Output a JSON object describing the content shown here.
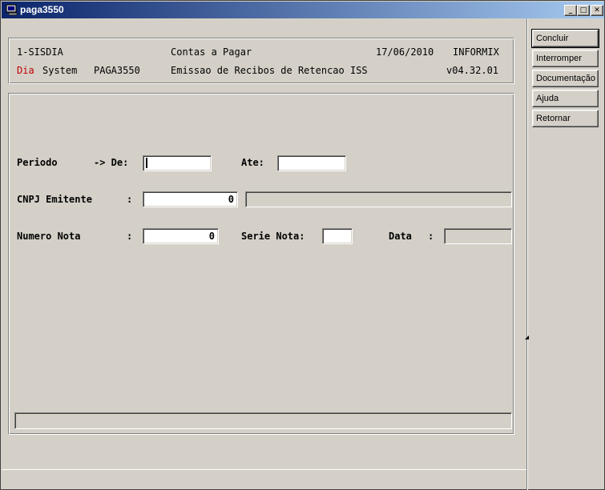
{
  "window": {
    "title": "paga3550",
    "minimize_glyph": "_",
    "maximize_glyph": "□",
    "close_glyph": "✕"
  },
  "header": {
    "company": "1-SISDIA",
    "module": "Contas a Pagar",
    "date": "17/06/2010",
    "db": "INFORMIX",
    "brand_dia": "Dia",
    "brand_system": "System",
    "program": "PAGA3550",
    "subtitle": "Emissao de Recibos de Retencao ISS",
    "version": "v04.32.01",
    "brand_color": "#c00000"
  },
  "form": {
    "periodo_label": "Periodo",
    "de_label": "-> De:",
    "de_value": "",
    "ate_label": "Ate:",
    "ate_value": "",
    "cnpj_label": "CNPJ Emitente",
    "cnpj_colon": ":",
    "cnpj_value": "0",
    "cnpj_name_value": "",
    "numero_label": "Numero Nota",
    "numero_colon": ":",
    "numero_value": "0",
    "serie_label": "Serie Nota:",
    "serie_value": "",
    "data_label": "Data",
    "data_colon": ":",
    "data_value": ""
  },
  "status": {
    "message": ""
  },
  "actions": [
    {
      "label": "Concluir"
    },
    {
      "label": "Interromper"
    },
    {
      "label": "Documentação"
    },
    {
      "label": "Ajuda"
    },
    {
      "label": "Retornar"
    }
  ]
}
